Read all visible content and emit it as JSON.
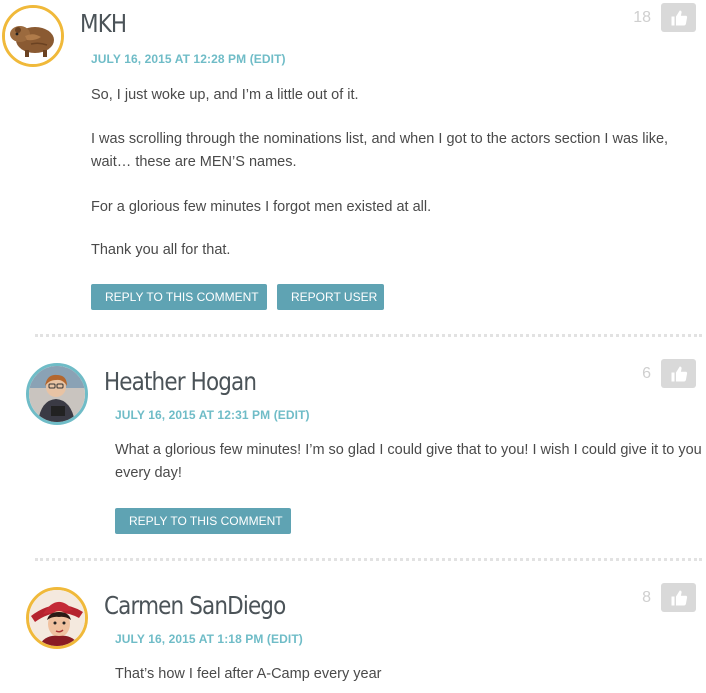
{
  "comments": [
    {
      "author": "MKH",
      "date": "JULY 16, 2015 AT 12:28 PM",
      "edit": "(EDIT)",
      "votes": "18",
      "paragraphs": [
        "So, I just woke up, and I’m a little out of it.",
        "I was scrolling through the nominations list, and when I got to the actors section I was like, wait… these are MEN’S names.",
        "For a glorious few minutes I forgot men existed at all.",
        "Thank you all for that."
      ],
      "reply_label": "REPLY TO THIS COMMENT",
      "report_label": "REPORT USER"
    },
    {
      "author": "Heather Hogan",
      "date": "JULY 16, 2015 AT 12:31 PM",
      "edit": "(EDIT)",
      "votes": "6",
      "paragraphs": [
        "What a glorious few minutes! I’m so glad I could give that to you! I wish I could give it to you every day!"
      ],
      "reply_label": "REPLY TO THIS COMMENT"
    },
    {
      "author": "Carmen SanDiego",
      "date": "JULY 16, 2015 AT 1:18 PM",
      "edit": "(EDIT)",
      "votes": "8",
      "paragraphs": [
        "That’s how I feel after A-Camp every year"
      ]
    }
  ],
  "colors": {
    "accent": "#6fbcc7",
    "button": "#5fa3b3",
    "avatar_ring": "#f0b93a",
    "like_button": "#d9d9d9"
  },
  "icons": {
    "like": "thumbs-up-icon"
  }
}
